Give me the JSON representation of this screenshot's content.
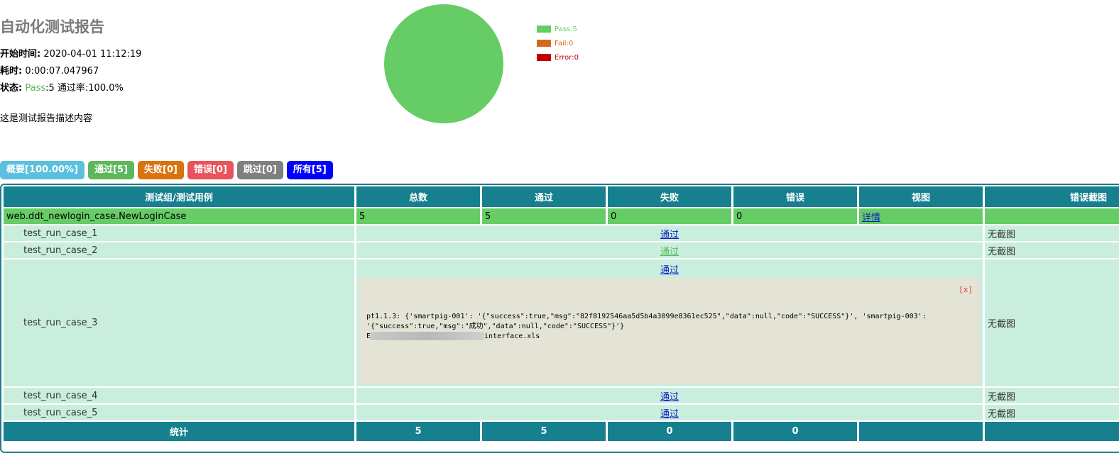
{
  "report": {
    "title": "自动化测试报告",
    "start_label": "开始时间:",
    "start_value": "2020-04-01 11:12:19",
    "duration_label": "耗时:",
    "duration_value": "0:00:07.047967",
    "status_label": "状态:",
    "status_pass_word": "Pass",
    "status_rest": ":5 通过率:100.0%",
    "description": "这是测试报告描述内容"
  },
  "chart_data": {
    "type": "pie",
    "categories": [
      "Pass",
      "Fail",
      "Error"
    ],
    "values": [
      5,
      0,
      0
    ],
    "colors": [
      "#66cc66",
      "#d2691e",
      "#c00000"
    ],
    "legend_labels": [
      "Pass:5",
      "Fail:0",
      "Error:0"
    ],
    "legend_position": "right"
  },
  "filters": [
    {
      "label": "概要[100.00%]",
      "color": "#5bc0de"
    },
    {
      "label": "通过[5]",
      "color": "#5cb85c"
    },
    {
      "label": "失败[0]",
      "color": "#d9730d"
    },
    {
      "label": "错误[0]",
      "color": "#e9545a"
    },
    {
      "label": "跳过[0]",
      "color": "#7f7f7f"
    },
    {
      "label": "所有[5]",
      "color": "#0000ff"
    }
  ],
  "table": {
    "headers": [
      "测试组/测试用例",
      "总数",
      "通过",
      "失败",
      "错误",
      "视图",
      "错误截图"
    ],
    "group": {
      "name": "web.ddt_newlogin_case.NewLoginCase",
      "total": "5",
      "pass": "5",
      "fail": "0",
      "error": "0",
      "view": "详情"
    },
    "cases": [
      {
        "name": "test_run_case_1",
        "status": "通过",
        "shot": "无截图"
      },
      {
        "name": "test_run_case_2",
        "status": "通过",
        "shot": "无截图"
      },
      {
        "name": "test_run_case_3",
        "status": "通过",
        "shot": "无截图"
      },
      {
        "name": "test_run_case_4",
        "status": "通过",
        "shot": "无截图"
      },
      {
        "name": "test_run_case_5",
        "status": "通过",
        "shot": "无截图"
      }
    ],
    "log": {
      "close": "[x]",
      "line1": "pt1.1.3: {'smartpig-001': '{\"success\":true,\"msg\":\"82f8192546aa5d5b4a3099e8361ec525\",\"data\":null,\"code\":\"SUCCESS\"}', 'smartpig-003':",
      "line2": "'{\"success\":true,\"msg\":\"成功\",\"data\":null,\"code\":\"SUCCESS\"}'}",
      "line3_start": "E",
      "line3_end": "interface.xls"
    },
    "footer": {
      "label": "统计",
      "total": "5",
      "pass": "5",
      "fail": "0",
      "error": "0"
    }
  }
}
